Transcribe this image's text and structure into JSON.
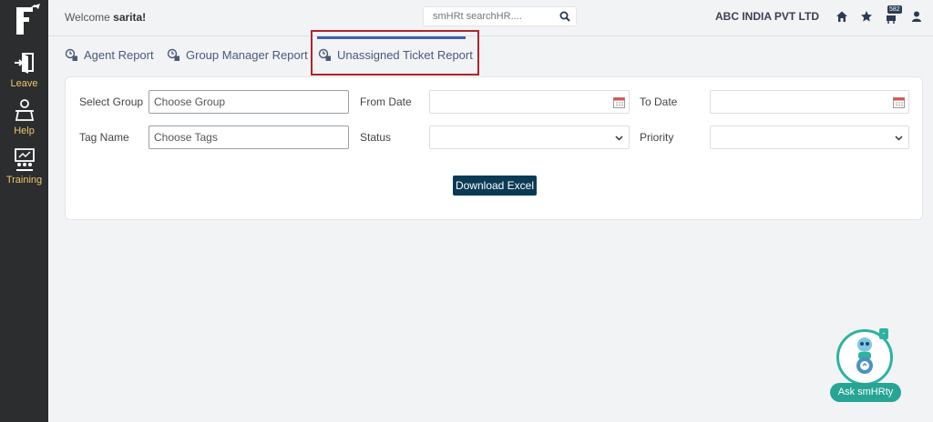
{
  "sidebar": {
    "items": [
      {
        "label": "Leave",
        "icon": "leave-icon"
      },
      {
        "label": "Help",
        "icon": "help-desk-icon"
      },
      {
        "label": "Training",
        "icon": "training-icon"
      }
    ]
  },
  "header": {
    "welcome_prefix": "Welcome ",
    "user_name": "sarita!",
    "search_placeholder": "smHRt searchHR....",
    "company": "ABC INDIA PVT LTD",
    "notification_count": "582"
  },
  "tabs": [
    {
      "label": "Agent Report",
      "active": false
    },
    {
      "label": "Group Manager Report",
      "active": false
    },
    {
      "label": "Unassigned Ticket Report",
      "active": true
    }
  ],
  "form": {
    "select_group_label": "Select Group",
    "select_group_placeholder": "Choose Group",
    "from_date_label": "From Date",
    "to_date_label": "To Date",
    "tag_name_label": "Tag Name",
    "tag_name_placeholder": "Choose Tags",
    "status_label": "Status",
    "priority_label": "Priority",
    "download_button": "Download Excel"
  },
  "chatbot": {
    "label": "Ask smHRty",
    "minimize": "-"
  },
  "colors": {
    "sidebar_bg": "#2b2d2f",
    "sidebar_label": "#f0c66a",
    "active_tab_bar": "#3f63a8",
    "highlight_border": "#b0242c",
    "button_bg": "#0b3a55",
    "chatbot_accent": "#26a594"
  }
}
